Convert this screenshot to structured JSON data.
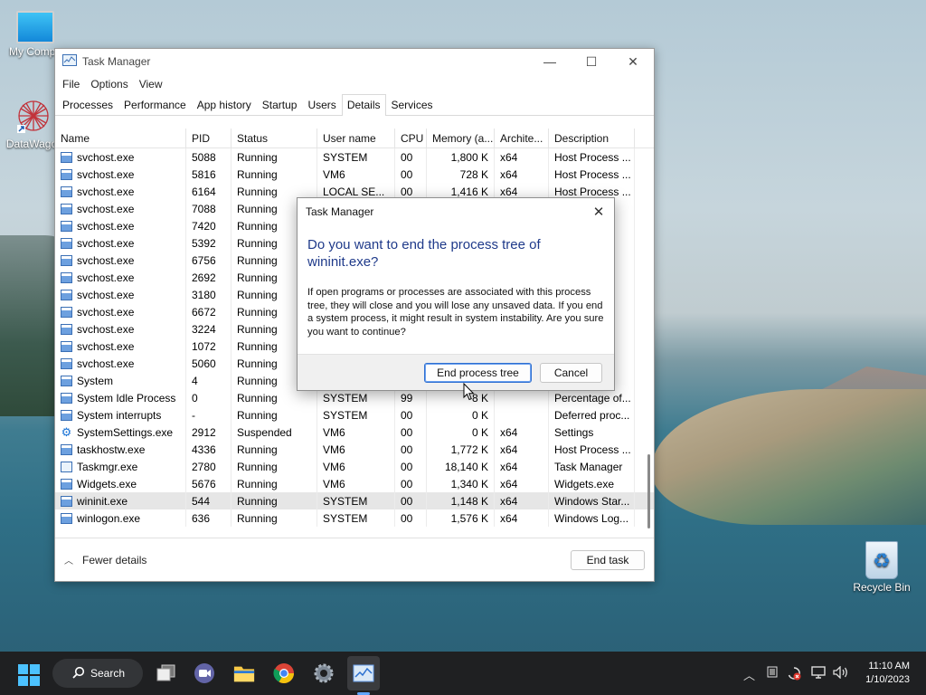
{
  "desktop": {
    "icons": [
      {
        "label": "My Compu"
      },
      {
        "label": "DataWagor"
      },
      {
        "label": "Recycle Bin"
      }
    ]
  },
  "window": {
    "title": "Task Manager",
    "controls": {
      "minimize": "—",
      "maximize": "☐",
      "close": "✕"
    },
    "menu": [
      "File",
      "Options",
      "View"
    ],
    "tabs": [
      "Processes",
      "Performance",
      "App history",
      "Startup",
      "Users",
      "Details",
      "Services"
    ],
    "active_tab": "Details",
    "columns": [
      "Name",
      "PID",
      "Status",
      "User name",
      "CPU",
      "Memory (a...",
      "Archite...",
      "Description"
    ],
    "rows": [
      {
        "name": "svchost.exe",
        "pid": "5088",
        "status": "Running",
        "user": "SYSTEM",
        "cpu": "00",
        "mem": "1,800 K",
        "arch": "x64",
        "desc": "Host Process ..."
      },
      {
        "name": "svchost.exe",
        "pid": "5816",
        "status": "Running",
        "user": "VM6",
        "cpu": "00",
        "mem": "728 K",
        "arch": "x64",
        "desc": "Host Process ..."
      },
      {
        "name": "svchost.exe",
        "pid": "6164",
        "status": "Running",
        "user": "LOCAL SE...",
        "cpu": "00",
        "mem": "1,416 K",
        "arch": "x64",
        "desc": "Host Process ..."
      },
      {
        "name": "svchost.exe",
        "pid": "7088",
        "status": "Running",
        "user": "",
        "cpu": "",
        "mem": "",
        "arch": "",
        "desc": "s ..."
      },
      {
        "name": "svchost.exe",
        "pid": "7420",
        "status": "Running",
        "user": "",
        "cpu": "",
        "mem": "",
        "arch": "",
        "desc": "s ..."
      },
      {
        "name": "svchost.exe",
        "pid": "5392",
        "status": "Running",
        "user": "",
        "cpu": "",
        "mem": "",
        "arch": "",
        "desc": "s ..."
      },
      {
        "name": "svchost.exe",
        "pid": "6756",
        "status": "Running",
        "user": "",
        "cpu": "",
        "mem": "",
        "arch": "",
        "desc": "s ..."
      },
      {
        "name": "svchost.exe",
        "pid": "2692",
        "status": "Running",
        "user": "",
        "cpu": "",
        "mem": "",
        "arch": "",
        "desc": "s ..."
      },
      {
        "name": "svchost.exe",
        "pid": "3180",
        "status": "Running",
        "user": "",
        "cpu": "",
        "mem": "",
        "arch": "",
        "desc": "s ..."
      },
      {
        "name": "svchost.exe",
        "pid": "6672",
        "status": "Running",
        "user": "",
        "cpu": "",
        "mem": "",
        "arch": "",
        "desc": "s ..."
      },
      {
        "name": "svchost.exe",
        "pid": "3224",
        "status": "Running",
        "user": "",
        "cpu": "",
        "mem": "",
        "arch": "",
        "desc": "s ..."
      },
      {
        "name": "svchost.exe",
        "pid": "1072",
        "status": "Running",
        "user": "",
        "cpu": "",
        "mem": "",
        "arch": "",
        "desc": "s ..."
      },
      {
        "name": "svchost.exe",
        "pid": "5060",
        "status": "Running",
        "user": "",
        "cpu": "",
        "mem": "",
        "arch": "",
        "desc": "s ..."
      },
      {
        "name": "System",
        "pid": "4",
        "status": "Running",
        "user": "",
        "cpu": "",
        "mem": "",
        "arch": "",
        "desc": "t S..."
      },
      {
        "name": "System Idle Process",
        "pid": "0",
        "status": "Running",
        "user": "SYSTEM",
        "cpu": "99",
        "mem": "8 K",
        "arch": "",
        "desc": "Percentage of..."
      },
      {
        "name": "System interrupts",
        "pid": "-",
        "status": "Running",
        "user": "SYSTEM",
        "cpu": "00",
        "mem": "0 K",
        "arch": "",
        "desc": "Deferred proc..."
      },
      {
        "name": "SystemSettings.exe",
        "pid": "2912",
        "status": "Suspended",
        "user": "VM6",
        "cpu": "00",
        "mem": "0 K",
        "arch": "x64",
        "desc": "Settings"
      },
      {
        "name": "taskhostw.exe",
        "pid": "4336",
        "status": "Running",
        "user": "VM6",
        "cpu": "00",
        "mem": "1,772 K",
        "arch": "x64",
        "desc": "Host Process ..."
      },
      {
        "name": "Taskmgr.exe",
        "pid": "2780",
        "status": "Running",
        "user": "VM6",
        "cpu": "00",
        "mem": "18,140 K",
        "arch": "x64",
        "desc": "Task Manager"
      },
      {
        "name": "Widgets.exe",
        "pid": "5676",
        "status": "Running",
        "user": "VM6",
        "cpu": "00",
        "mem": "1,340 K",
        "arch": "x64",
        "desc": "Widgets.exe"
      },
      {
        "name": "wininit.exe",
        "pid": "544",
        "status": "Running",
        "user": "SYSTEM",
        "cpu": "00",
        "mem": "1,148 K",
        "arch": "x64",
        "desc": "Windows Star..."
      },
      {
        "name": "winlogon.exe",
        "pid": "636",
        "status": "Running",
        "user": "SYSTEM",
        "cpu": "00",
        "mem": "1,576 K",
        "arch": "x64",
        "desc": "Windows Log..."
      }
    ],
    "selected_row": "wininit.exe",
    "footer": {
      "fewer_details": "Fewer details",
      "end_task": "End task"
    }
  },
  "dialog": {
    "title": "Task Manager",
    "close": "✕",
    "heading": "Do you want to end the process tree of wininit.exe?",
    "body": "If open programs or processes are associated with this process tree, they will close and you will lose any unsaved data. If you end a system process, it might result in system instability. Are you sure you want to continue?",
    "primary": "End process tree",
    "cancel": "Cancel"
  },
  "taskbar": {
    "search": "Search",
    "time": "11:10 AM",
    "date": "1/10/2023"
  },
  "colors": {
    "accent": "#1f3a8a",
    "selection": "#e6e6e6",
    "taskbar": "#1f2022"
  }
}
